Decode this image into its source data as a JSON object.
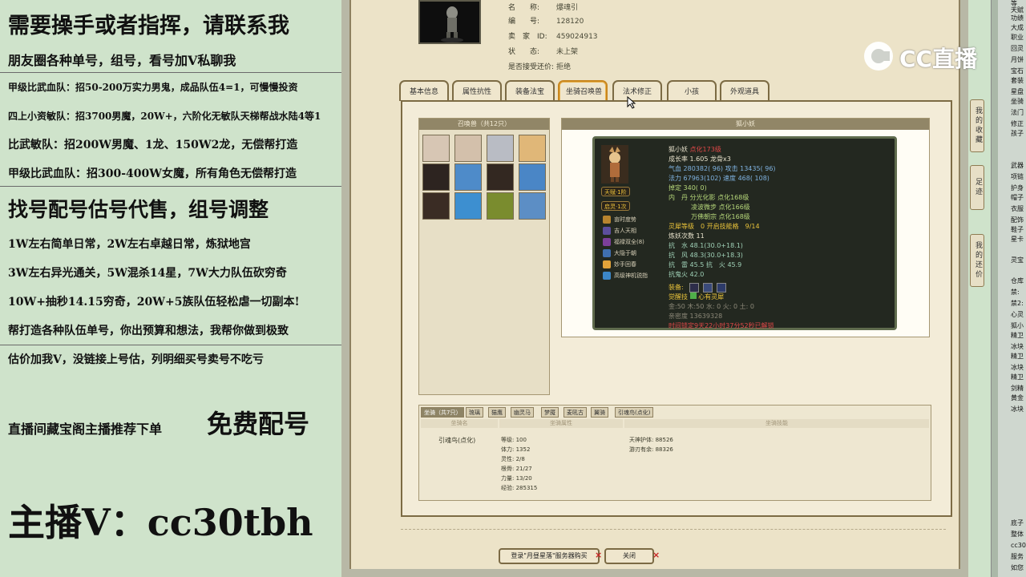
{
  "ad_panel": {
    "lines": [
      "需要操手或者指挥，请联系我",
      "朋友圈各种单号，组号，看号加V私聊我",
      "甲级比武血队：招50-200万实力男鬼，成品队伍4=1，可慢慢投资",
      "四上小资敏队：招3700男魔，20W+，六阶化无敏队天梯帮战水陆4等1",
      "比武敏队：招200W男魔、1龙、150W2龙，无偿帮打造",
      "甲级比武血队：招300-400W女魔，所有角色无偿帮打造",
      "找号配号估号代售，组号调整",
      "1W左右简单日常，2W左右卓越日常，炼狱地宫",
      "3W左右异光通关，5W混杀14星，7W大力队伍砍穷奇",
      "10W+抽秒14.15穷奇，20W+5族队伍轻松虐一切副本!",
      "帮打造各种队伍单号，你出预算和想法，我帮你做到极致",
      "估价加我V，没链接上号估，列明细买号卖号不吃亏",
      "直播间藏宝阁主播推荐下单",
      "免费配号",
      "主播V：cc30tbh"
    ]
  },
  "char_info": {
    "name_key": "名　　称:",
    "name_val": "爆魂引",
    "id_key": "编　　号:",
    "id_val": "128120",
    "seller_key": "卖　家　ID:",
    "seller_val": "459024913",
    "status_key": "状　　态:",
    "status_val": "未上架",
    "bargain_key": "是否接受还价:",
    "bargain_val": "拒绝"
  },
  "tabs": [
    "基本信息",
    "属性抗性",
    "装备法宝",
    "坐骑召唤兽",
    "法术修正",
    "小孩",
    "外观道具"
  ],
  "summon_list": {
    "header": "召唤兽（共12只）"
  },
  "detail": {
    "header": "狐小妖",
    "card": {
      "name": "狐小妖",
      "tag": "点化173级",
      "growth": "成长率 1.605 龙骨x3",
      "hp": "气血 280382( 96) 攻击 13435( 96)",
      "mp": "法力 67963(102) 速度 468( 108)",
      "ding": "掉定 340( 0)",
      "nei": "内　丹 分光化影 点化168级",
      "nei2": "凌波微步 点化166级",
      "nei3": "万佛朝宗 点化168级",
      "lingxi": "灵犀等级　0 开启技能格　9/14",
      "lianyao": "炼妖次数 11",
      "kang1": "抗　水 48.1(30.0+18.1)",
      "kang2": "抗　风 48.3(30.0+18.3)",
      "kang3": "抗　雷 45.5 抗　火 45.9",
      "kang4": "抗鬼火 42.0",
      "equip": "装备:",
      "juexing": "觉醒技",
      "juexing_val": "心有灵犀",
      "elements": "金:50 木:50 水: 0 火: 0 土: 0",
      "qinmi": "亲密度 13639328",
      "timer": "时间锁定9天22小时37分52秒",
      "timer_tag": "已解锁",
      "badge1": "天赋·1阶",
      "badge2": "启灵·1次",
      "skills": [
        "亩时度势",
        "吉人天相",
        "福禄双全(8)",
        "大隐于朝",
        "妙手回春",
        "高级神机锐指"
      ]
    }
  },
  "mount": {
    "tabs": [
      "坐骑（共7只）",
      "琉璃",
      "猫鹰",
      "幽灵马",
      "梦魇",
      "麦吼古",
      "翼骑",
      "引魂鸟(点化)"
    ],
    "cols": [
      "坐骑名",
      "坐骑属性",
      "坐骑技能"
    ],
    "name": "引魂鸟(点化)",
    "attrs": [
      "等级: 100",
      "体力: 1352",
      "灵性: 2/8",
      "根骨: 21/27",
      "力量: 13/20",
      "经验: 285315"
    ],
    "skills": [
      "天神护体: 88526",
      "游刃有余: 88326"
    ]
  },
  "buttons": {
    "login": "登录\"月昼星落\"服务器购买",
    "close": "关闭",
    "x": "×"
  },
  "side_buttons": [
    "我的收藏",
    "足迹",
    "我的还价"
  ],
  "right_panel": [
    "等",
    "天赋",
    "功绩",
    "大成",
    "职业",
    "回灵",
    "月饼",
    "宝石",
    "套装",
    "星盘",
    "坐骑",
    "法门",
    "修正",
    "孩子",
    "武器",
    "项链",
    "护身",
    "帽子",
    "衣服",
    "配饰",
    "鞋子",
    "星卡",
    "灵宝",
    "仓库",
    "禁:",
    "禁2:",
    "心灵",
    "狐小",
    "精卫",
    "冰块",
    "精卫",
    "冰块",
    "精卫",
    "剑精",
    "黄金",
    "冰块",
    "底子",
    "整体",
    "cc30",
    "服务",
    "如您"
  ],
  "logo_text": "CC直播"
}
